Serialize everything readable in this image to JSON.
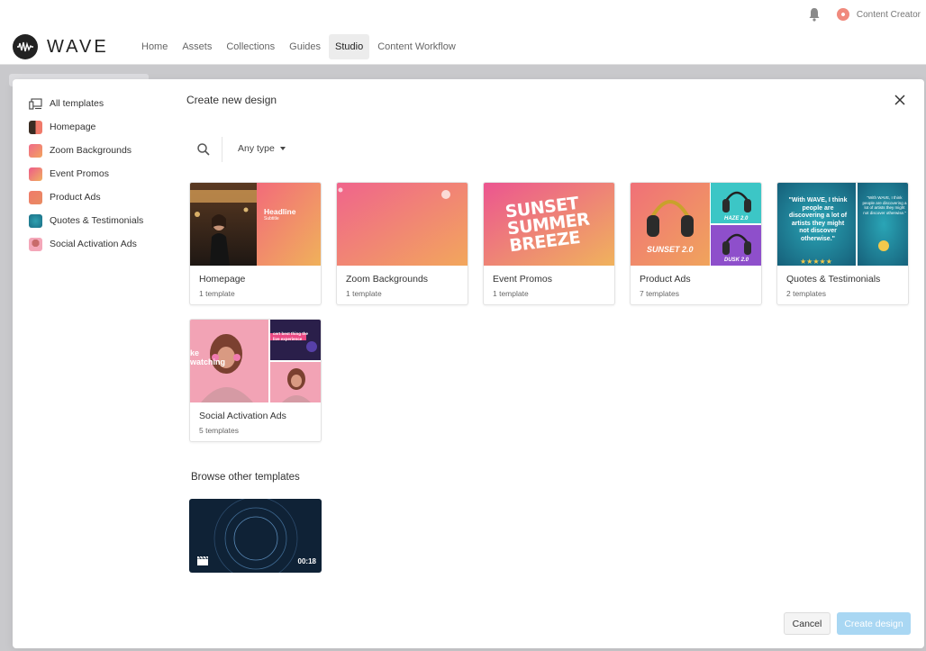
{
  "header": {
    "brand": "WAVE",
    "user_name": "Content Creator",
    "nav": [
      "Home",
      "Assets",
      "Collections",
      "Guides",
      "Studio",
      "Content Workflow"
    ],
    "active_nav": "Studio"
  },
  "modal": {
    "title": "Create new design",
    "type_filter": "Any type",
    "sidebar": [
      {
        "label": "All templates",
        "icon": "devices-icon"
      },
      {
        "label": "Homepage",
        "icon": "homepage-thumb"
      },
      {
        "label": "Zoom Backgrounds",
        "icon": "zoom-backgrounds-thumb"
      },
      {
        "label": "Event Promos",
        "icon": "event-promos-thumb"
      },
      {
        "label": "Product Ads",
        "icon": "product-ads-thumb"
      },
      {
        "label": "Quotes & Testimonials",
        "icon": "quotes-thumb"
      },
      {
        "label": "Social Activation Ads",
        "icon": "social-ads-thumb"
      }
    ],
    "cards": [
      {
        "name": "Homepage",
        "count": "1 template"
      },
      {
        "name": "Zoom Backgrounds",
        "count": "1 template"
      },
      {
        "name": "Event Promos",
        "count": "1 template"
      },
      {
        "name": "Product Ads",
        "count": "7 templates"
      },
      {
        "name": "Quotes & Testimonials",
        "count": "2 templates"
      },
      {
        "name": "Social Activation Ads",
        "count": "5 templates"
      }
    ],
    "thumb_text": {
      "homepage_headline": "Headline",
      "homepage_subtitle": "Subtitle",
      "event_line1": "SUNSET",
      "event_line2": "SUMMER",
      "event_line3": "BREEZE",
      "product_main": "SUNSET 2.0",
      "product_haze": "HAZE 2.0",
      "product_dusk": "DUSK 2.0",
      "quote_main": "\"With WAVE, I think people are discovering a lot of artists they might not discover otherwise.\"",
      "quote_small": "\"With WAVE, I think people are discovering a lot of artists they might not discover otherwise.\"",
      "social_side": "ke watching",
      "social_right": "cert best thing the live experience"
    },
    "browse_title": "Browse other templates",
    "video_duration": "00:18",
    "buttons": {
      "cancel": "Cancel",
      "create": "Create design"
    }
  },
  "colors": {
    "primary_disabled": "#a9d7f3",
    "zoom_gradient": [
      "#f06a8a",
      "#f2a35e"
    ],
    "event_gradient": [
      "#ee5a8a",
      "#f0b060"
    ]
  }
}
